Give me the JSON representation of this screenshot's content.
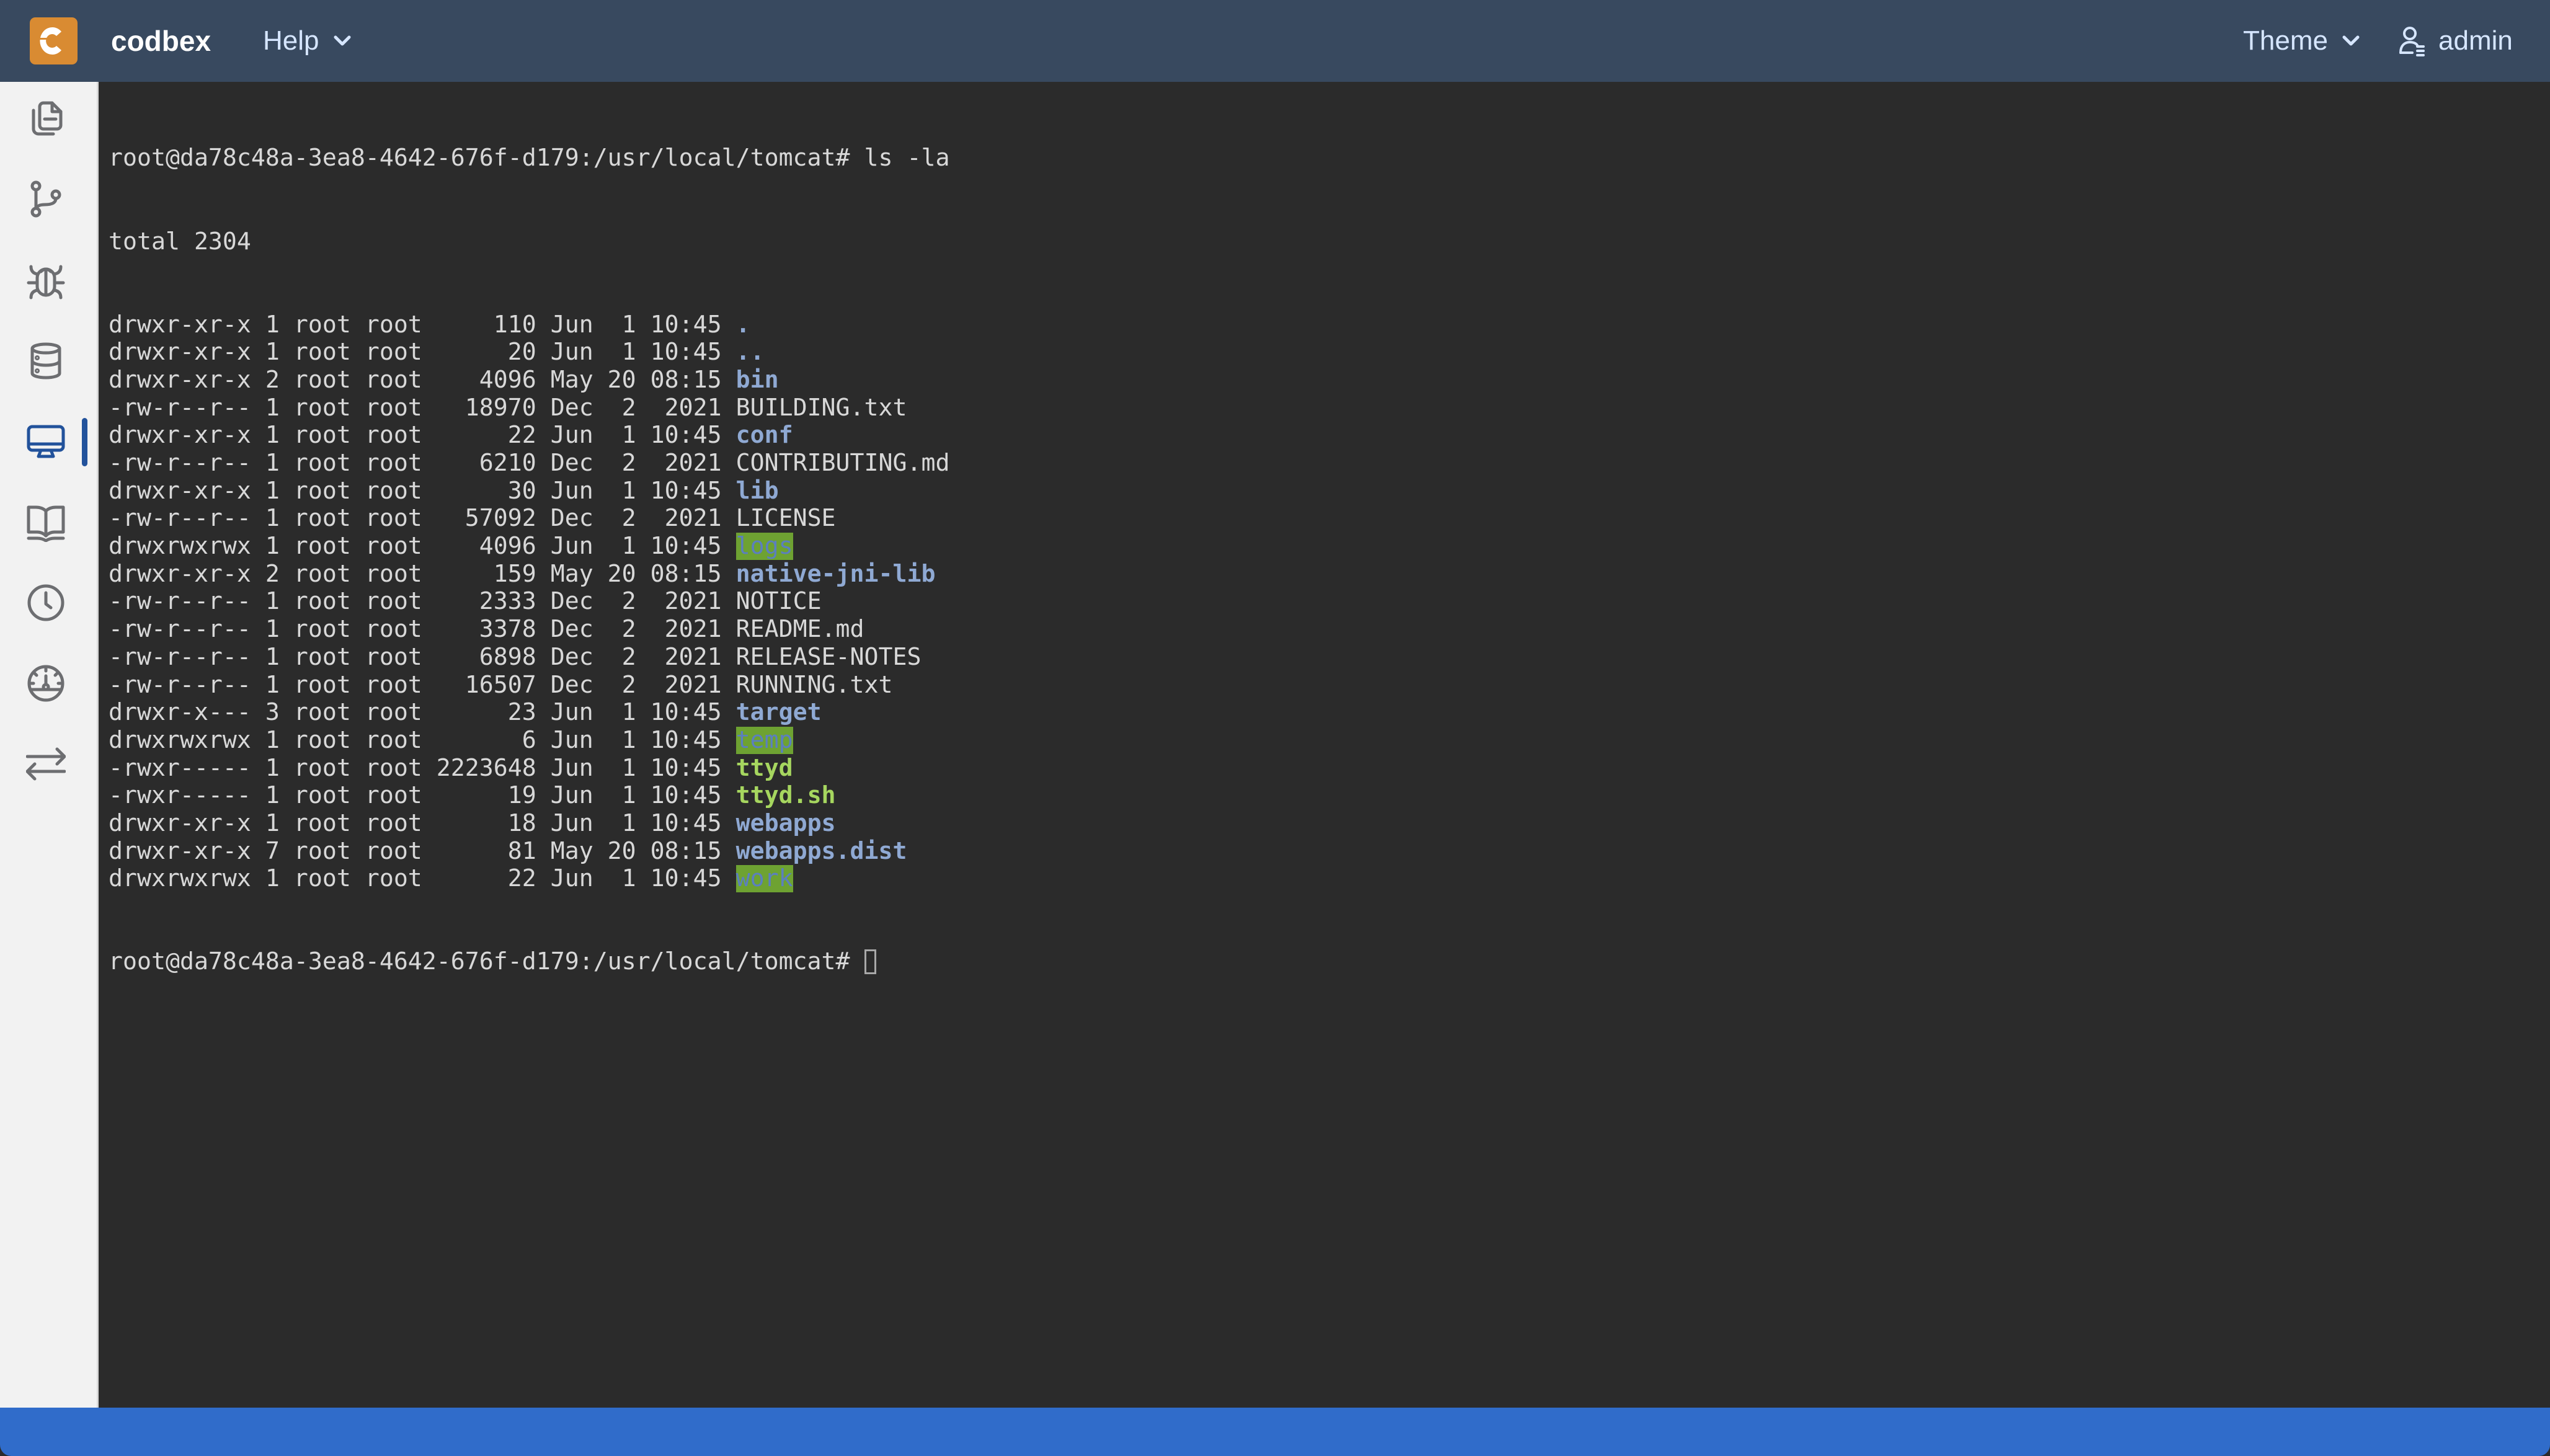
{
  "app": {
    "brand": "codbex",
    "colors": {
      "header_bg": "#38495f",
      "logo_bg": "#d98b32",
      "sidebar_bg": "#f2f2f2",
      "active_accent": "#22529b",
      "terminal_bg": "#2b2b2b",
      "statusbar_bg": "#306cca"
    }
  },
  "header": {
    "logo_icon": "codbex-logo-icon",
    "menus": {
      "help": {
        "label": "Help",
        "icon": "chevron-down-icon"
      },
      "theme": {
        "label": "Theme",
        "icon": "chevron-down-icon"
      },
      "user": {
        "label": "admin",
        "icon": "user-settings-icon"
      }
    }
  },
  "sidebar": {
    "items": [
      {
        "name": "workbench",
        "icon": "files-icon",
        "active": false
      },
      {
        "name": "git",
        "icon": "git-branch-icon",
        "active": false
      },
      {
        "name": "debugger",
        "icon": "bug-icon",
        "active": false
      },
      {
        "name": "database",
        "icon": "database-icon",
        "active": false
      },
      {
        "name": "terminal",
        "icon": "monitor-icon",
        "active": true
      },
      {
        "name": "documentation",
        "icon": "book-open-icon",
        "active": false
      },
      {
        "name": "jobs",
        "icon": "clock-icon",
        "active": false
      },
      {
        "name": "operations",
        "icon": "gauge-icon",
        "active": false
      },
      {
        "name": "transport",
        "icon": "arrows-exchange-icon",
        "active": false
      }
    ]
  },
  "terminal": {
    "prompt": "root@da78c48a-3ea8-4642-676f-d179:/usr/local/tomcat# ",
    "command": "ls -la",
    "total_line": "total 2304",
    "entries": [
      {
        "perms": "drwxr-xr-x",
        "links": "1",
        "owner": "root",
        "group": "root",
        "size": "110",
        "date": "Jun  1 10:45",
        "name": ".",
        "kind": "dir"
      },
      {
        "perms": "drwxr-xr-x",
        "links": "1",
        "owner": "root",
        "group": "root",
        "size": "20",
        "date": "Jun  1 10:45",
        "name": "..",
        "kind": "dir"
      },
      {
        "perms": "drwxr-xr-x",
        "links": "2",
        "owner": "root",
        "group": "root",
        "size": "4096",
        "date": "May 20 08:15",
        "name": "bin",
        "kind": "dir"
      },
      {
        "perms": "-rw-r--r--",
        "links": "1",
        "owner": "root",
        "group": "root",
        "size": "18970",
        "date": "Dec  2  2021",
        "name": "BUILDING.txt",
        "kind": "file"
      },
      {
        "perms": "drwxr-xr-x",
        "links": "1",
        "owner": "root",
        "group": "root",
        "size": "22",
        "date": "Jun  1 10:45",
        "name": "conf",
        "kind": "dir"
      },
      {
        "perms": "-rw-r--r--",
        "links": "1",
        "owner": "root",
        "group": "root",
        "size": "6210",
        "date": "Dec  2  2021",
        "name": "CONTRIBUTING.md",
        "kind": "file"
      },
      {
        "perms": "drwxr-xr-x",
        "links": "1",
        "owner": "root",
        "group": "root",
        "size": "30",
        "date": "Jun  1 10:45",
        "name": "lib",
        "kind": "dir"
      },
      {
        "perms": "-rw-r--r--",
        "links": "1",
        "owner": "root",
        "group": "root",
        "size": "57092",
        "date": "Dec  2  2021",
        "name": "LICENSE",
        "kind": "file"
      },
      {
        "perms": "drwxrwxrwx",
        "links": "1",
        "owner": "root",
        "group": "root",
        "size": "4096",
        "date": "Jun  1 10:45",
        "name": "logs",
        "kind": "other-writable-dir"
      },
      {
        "perms": "drwxr-xr-x",
        "links": "2",
        "owner": "root",
        "group": "root",
        "size": "159",
        "date": "May 20 08:15",
        "name": "native-jni-lib",
        "kind": "dir"
      },
      {
        "perms": "-rw-r--r--",
        "links": "1",
        "owner": "root",
        "group": "root",
        "size": "2333",
        "date": "Dec  2  2021",
        "name": "NOTICE",
        "kind": "file"
      },
      {
        "perms": "-rw-r--r--",
        "links": "1",
        "owner": "root",
        "group": "root",
        "size": "3378",
        "date": "Dec  2  2021",
        "name": "README.md",
        "kind": "file"
      },
      {
        "perms": "-rw-r--r--",
        "links": "1",
        "owner": "root",
        "group": "root",
        "size": "6898",
        "date": "Dec  2  2021",
        "name": "RELEASE-NOTES",
        "kind": "file"
      },
      {
        "perms": "-rw-r--r--",
        "links": "1",
        "owner": "root",
        "group": "root",
        "size": "16507",
        "date": "Dec  2  2021",
        "name": "RUNNING.txt",
        "kind": "file"
      },
      {
        "perms": "drwxr-x---",
        "links": "3",
        "owner": "root",
        "group": "root",
        "size": "23",
        "date": "Jun  1 10:45",
        "name": "target",
        "kind": "dir"
      },
      {
        "perms": "drwxrwxrwx",
        "links": "1",
        "owner": "root",
        "group": "root",
        "size": "6",
        "date": "Jun  1 10:45",
        "name": "temp",
        "kind": "other-writable-dir"
      },
      {
        "perms": "-rwxr-----",
        "links": "1",
        "owner": "root",
        "group": "root",
        "size": "2223648",
        "date": "Jun  1 10:45",
        "name": "ttyd",
        "kind": "exec"
      },
      {
        "perms": "-rwxr-----",
        "links": "1",
        "owner": "root",
        "group": "root",
        "size": "19",
        "date": "Jun  1 10:45",
        "name": "ttyd.sh",
        "kind": "exec"
      },
      {
        "perms": "drwxr-xr-x",
        "links": "1",
        "owner": "root",
        "group": "root",
        "size": "18",
        "date": "Jun  1 10:45",
        "name": "webapps",
        "kind": "dir"
      },
      {
        "perms": "drwxr-xr-x",
        "links": "7",
        "owner": "root",
        "group": "root",
        "size": "81",
        "date": "May 20 08:15",
        "name": "webapps.dist",
        "kind": "dir"
      },
      {
        "perms": "drwxrwxrwx",
        "links": "1",
        "owner": "root",
        "group": "root",
        "size": "22",
        "date": "Jun  1 10:45",
        "name": "work",
        "kind": "other-writable-dir"
      }
    ],
    "colors": {
      "text": "#d8d8d8",
      "dir": "#8fa9d3",
      "exec": "#a6d65f",
      "other_writable_bg": "#6ea232",
      "other_writable_fg": "#5b7fbf"
    },
    "current_input": ""
  },
  "statusbar": {}
}
